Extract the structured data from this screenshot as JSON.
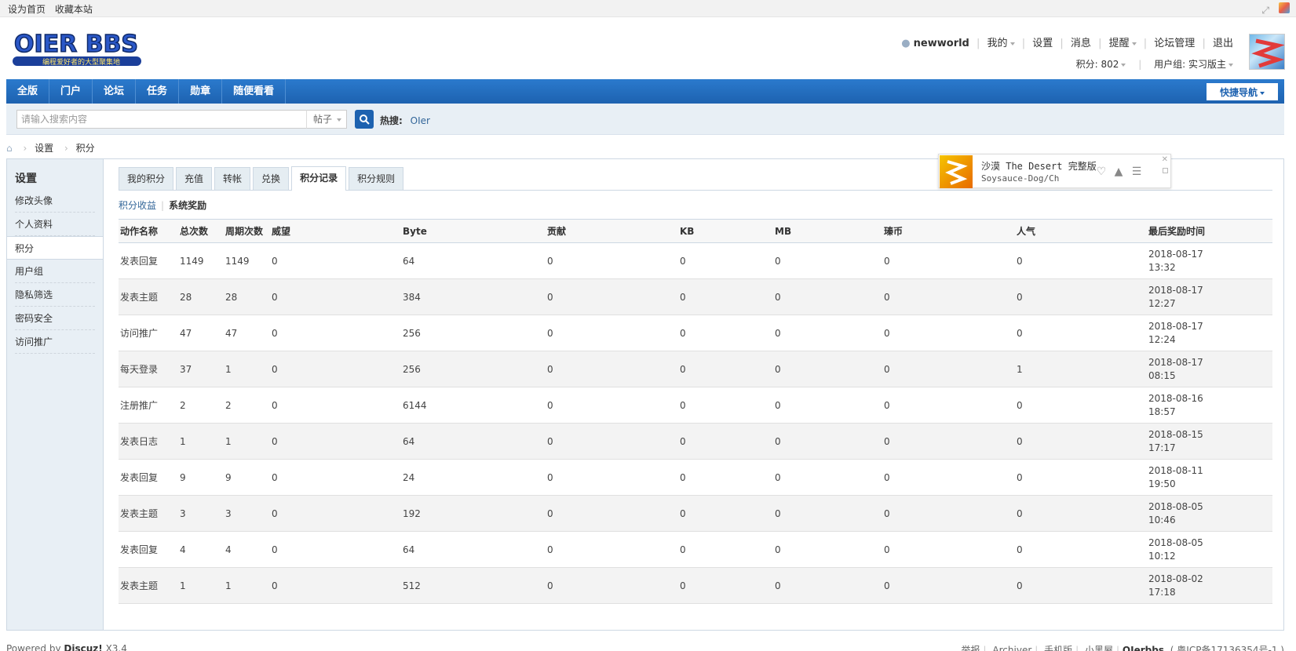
{
  "topbar": {
    "set_home": "设为首页",
    "bookmark": "收藏本站"
  },
  "header": {
    "logo_text": "OIER BBS",
    "logo_subtext": "编程爱好者的大型聚集地",
    "username": "newworld",
    "menu": [
      "我的",
      "设置",
      "消息",
      "提醒",
      "论坛管理",
      "退出"
    ],
    "points_label": "积分: 802",
    "usergroup_label": "用户组: 实习版主"
  },
  "nav": {
    "items": [
      "全版",
      "门户",
      "论坛",
      "任务",
      "勋章",
      "随便看看"
    ],
    "quick_nav": "快捷导航"
  },
  "search": {
    "placeholder": "请输入搜索内容",
    "type": "帖子",
    "hot_label": "热搜:",
    "hot_term": "OIer"
  },
  "breadcrumb": [
    "设置",
    "积分"
  ],
  "sidebar": {
    "title": "设置",
    "items": [
      "修改头像",
      "个人资料",
      "积分",
      "用户组",
      "隐私筛选",
      "密码安全",
      "访问推广"
    ]
  },
  "tabs": [
    "我的积分",
    "充值",
    "转帐",
    "兑换",
    "积分记录",
    "积分规则"
  ],
  "subtabs": {
    "income": "积分收益",
    "system": "系统奖励"
  },
  "table": {
    "headers": [
      "动作名称",
      "总次数",
      "周期次数",
      "威望",
      "Byte",
      "贡献",
      "KB",
      "MB",
      "瑧币",
      "人气",
      "最后奖励时间"
    ],
    "rows": [
      {
        "action": "发表回复",
        "total": "1149",
        "cycle": "1149",
        "prestige": "0",
        "byte": "64",
        "contrib": "0",
        "kb": "0",
        "mb": "0",
        "coin": "0",
        "pop": "0",
        "date": "2018-08-17",
        "time": "13:32"
      },
      {
        "action": "发表主题",
        "total": "28",
        "cycle": "28",
        "prestige": "0",
        "byte": "384",
        "contrib": "0",
        "kb": "0",
        "mb": "0",
        "coin": "0",
        "pop": "0",
        "date": "2018-08-17",
        "time": "12:27"
      },
      {
        "action": "访问推广",
        "total": "47",
        "cycle": "47",
        "prestige": "0",
        "byte": "256",
        "contrib": "0",
        "kb": "0",
        "mb": "0",
        "coin": "0",
        "pop": "0",
        "date": "2018-08-17",
        "time": "12:24"
      },
      {
        "action": "每天登录",
        "total": "37",
        "cycle": "1",
        "prestige": "0",
        "byte": "256",
        "contrib": "0",
        "kb": "0",
        "mb": "0",
        "coin": "0",
        "pop": "1",
        "date": "2018-08-17",
        "time": "08:15"
      },
      {
        "action": "注册推广",
        "total": "2",
        "cycle": "2",
        "prestige": "0",
        "byte": "6144",
        "contrib": "0",
        "kb": "0",
        "mb": "0",
        "coin": "0",
        "pop": "0",
        "date": "2018-08-16",
        "time": "18:57"
      },
      {
        "action": "发表日志",
        "total": "1",
        "cycle": "1",
        "prestige": "0",
        "byte": "64",
        "contrib": "0",
        "kb": "0",
        "mb": "0",
        "coin": "0",
        "pop": "0",
        "date": "2018-08-15",
        "time": "17:17"
      },
      {
        "action": "发表回复",
        "total": "9",
        "cycle": "9",
        "prestige": "0",
        "byte": "24",
        "contrib": "0",
        "kb": "0",
        "mb": "0",
        "coin": "0",
        "pop": "0",
        "date": "2018-08-11",
        "time": "19:50"
      },
      {
        "action": "发表主题",
        "total": "3",
        "cycle": "3",
        "prestige": "0",
        "byte": "192",
        "contrib": "0",
        "kb": "0",
        "mb": "0",
        "coin": "0",
        "pop": "0",
        "date": "2018-08-05",
        "time": "10:46"
      },
      {
        "action": "发表回复",
        "total": "4",
        "cycle": "4",
        "prestige": "0",
        "byte": "64",
        "contrib": "0",
        "kb": "0",
        "mb": "0",
        "coin": "0",
        "pop": "0",
        "date": "2018-08-05",
        "time": "10:12"
      },
      {
        "action": "发表主题",
        "total": "1",
        "cycle": "1",
        "prestige": "0",
        "byte": "512",
        "contrib": "0",
        "kb": "0",
        "mb": "0",
        "coin": "0",
        "pop": "0",
        "date": "2018-08-02",
        "time": "17:18"
      }
    ]
  },
  "music": {
    "title": "沙漠 The Desert 完整版",
    "artist": "Soysauce-Dog/Cheeta…"
  },
  "footer": {
    "powered": "Powered by",
    "brand": "Discuz!",
    "version": "X3.4",
    "links": [
      "举报",
      "Archiver",
      "手机版",
      "小黑屋"
    ],
    "site": "OIerbbs",
    "icp": "( 粤ICP备17136354号-1 )"
  },
  "colors": {
    "nav_blue": "#1d62b0",
    "sidebar_bg": "#e8eff5",
    "link": "#336699"
  }
}
